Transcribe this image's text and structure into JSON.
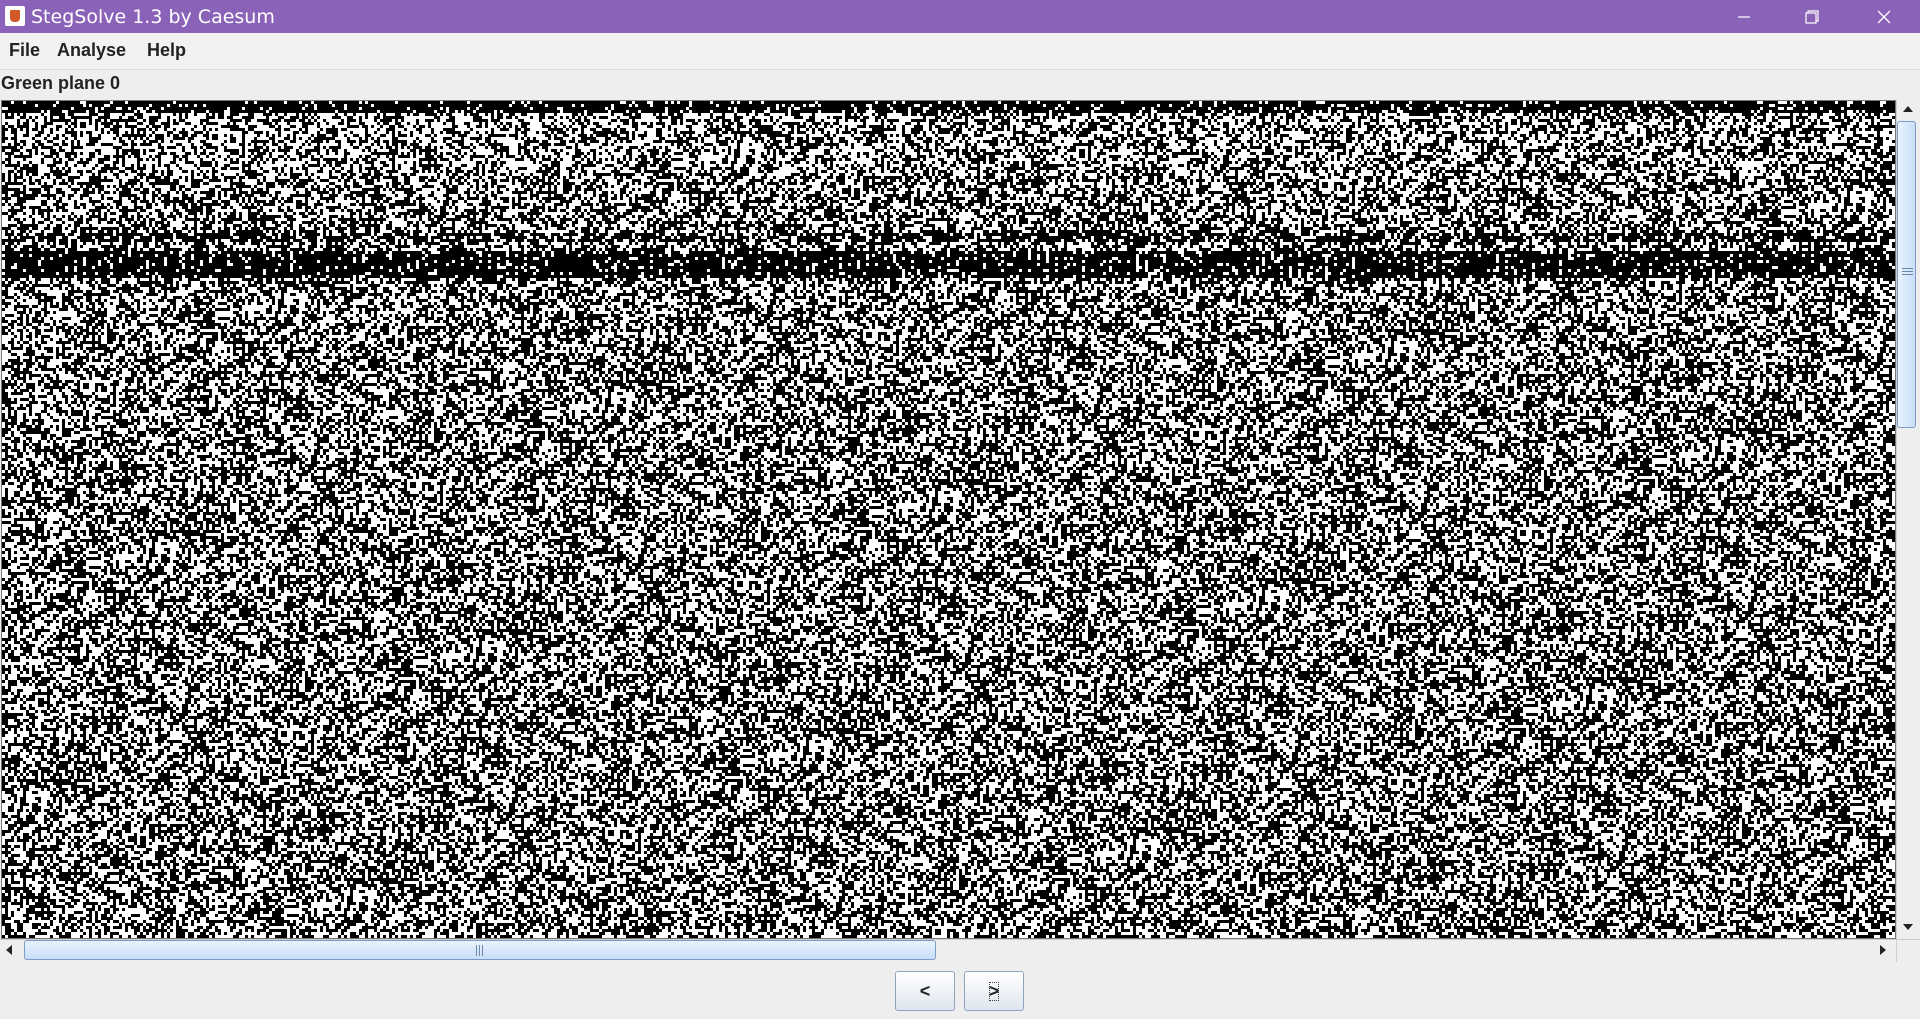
{
  "window": {
    "title": "StegSolve 1.3 by Caesum",
    "controls": [
      "minimize-icon",
      "restore-icon",
      "close-icon"
    ]
  },
  "menu": {
    "items": [
      {
        "label": "File"
      },
      {
        "label": "Analyse"
      },
      {
        "label": "Help"
      }
    ]
  },
  "viewer": {
    "plane_label": "Green plane 0"
  },
  "navigation": {
    "prev_label": "<",
    "next_label": ">"
  },
  "colors": {
    "titlebar": "#8a63b8",
    "background": "#eeeeee",
    "scroll_thumb": "#c9defa"
  },
  "icons": {
    "app": "stegsolve-java-icon",
    "scroll_up": "triangle-up-icon",
    "scroll_down": "triangle-down-icon",
    "scroll_left": "triangle-left-icon",
    "scroll_right": "triangle-right-icon"
  }
}
